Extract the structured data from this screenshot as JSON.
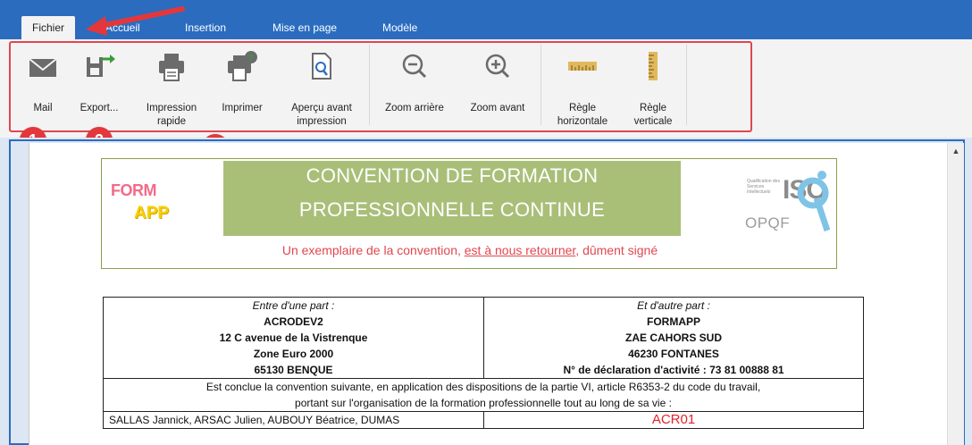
{
  "menu": {
    "tabs": [
      "Fichier",
      "Accueil",
      "Insertion",
      "Mise en page",
      "Modèle"
    ]
  },
  "ribbon": {
    "buttons": [
      {
        "label": "Mail",
        "icon": "mail-icon"
      },
      {
        "label": "Export...",
        "icon": "export-icon"
      },
      {
        "label": "Impression rapide",
        "icon": "quick-print-icon"
      },
      {
        "label": "Imprimer",
        "icon": "print-icon"
      },
      {
        "label": "Aperçu avant impression",
        "icon": "print-preview-icon"
      },
      {
        "label": "Zoom arrière",
        "icon": "zoom-out-icon"
      },
      {
        "label": "Zoom avant",
        "icon": "zoom-in-icon"
      },
      {
        "label": "Règle horizontale",
        "icon": "horizontal-ruler-icon"
      },
      {
        "label": "Règle verticale",
        "icon": "vertical-ruler-icon"
      }
    ]
  },
  "badges": [
    "1",
    "2",
    "3"
  ],
  "document": {
    "logo_top": "FORM",
    "logo_bottom": "APP",
    "title_line1": "CONVENTION DE FORMATION",
    "title_line2": "PROFESSIONNELLE CONTINUE",
    "subtitle_part1": "Un exemplaire de la convention, ",
    "subtitle_underlined": "est à nous retourner",
    "subtitle_part2": ", dûment signé",
    "isq_small": "Qualification des Services Intellectuels",
    "isq_letters": "ISQ",
    "opqf": "OPQF",
    "left_party": {
      "heading": "Entre d'une part :",
      "name": "ACRODEV2",
      "address1": "12 C avenue de la Vistrenque",
      "address2": "Zone Euro 2000",
      "address3": "65130 BENQUE"
    },
    "right_party": {
      "heading": "Et d'autre part :",
      "name": "FORMAPP",
      "address1": "ZAE CAHORS SUD",
      "address2": "46230 FONTANES",
      "declaration": "N° de déclaration d'activité : 73 81 00888 81"
    },
    "conclusion_line1": "Est conclue la convention suivante, en application des dispositions de la partie VI, article R6353-2 du code du travail,",
    "conclusion_line2": "portant sur l'organisation de la formation professionnelle tout au long de sa vie :",
    "participants": "SALLAS Jannick, ARSAC Julien, AUBOUY Béatrice, DUMAS",
    "reference": "ACR01"
  },
  "colors": {
    "menubar": "#2b6cbf",
    "highlight": "#e0474f",
    "title_band": "#a9bf78"
  }
}
